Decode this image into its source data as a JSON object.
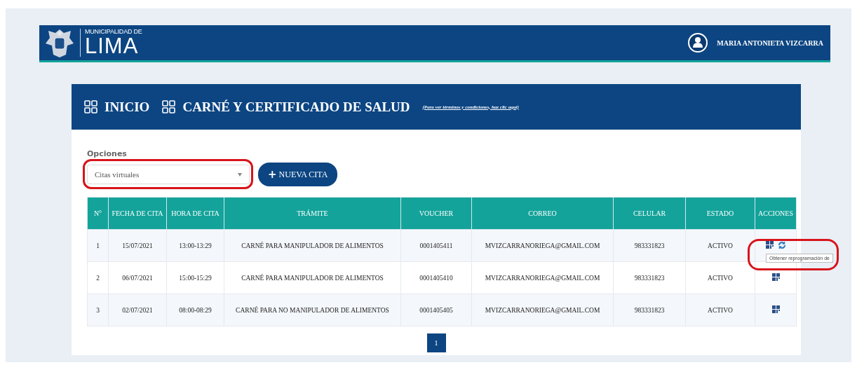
{
  "header": {
    "org_small": "MUNICIPALIDAD DE",
    "org_big": "LIMA",
    "user_name": "MARIA ANTONIETA VIZCARRA"
  },
  "breadcrumb": [
    {
      "label": "INICIO"
    },
    {
      "label": "CARNÉ Y CERTIFICADO DE SALUD"
    }
  ],
  "terms_link": "(Para ver términos y condiciones, haz clic aquí)",
  "options": {
    "label": "Opciones",
    "value": "Citas virtuales",
    "highlighted": true
  },
  "new_button": {
    "icon": "+",
    "label": "NUEVA CITA"
  },
  "table": {
    "columns": [
      "N°",
      "FECHA DE CITA",
      "HORA DE CITA",
      "TRÁMITE",
      "VOUCHER",
      "CORREO",
      "CELULAR",
      "ESTADO",
      "ACCIONES"
    ],
    "rows": [
      {
        "cells": [
          "1",
          "15/07/2021",
          "13:00-13:29",
          "CARNÉ PARA MANIPULADOR DE ALIMENTOS",
          "0001405411",
          "MVIZCARRANORIEGA@GMAIL.COM",
          "983331823",
          "ACTIVO"
        ],
        "actions": [
          {
            "kind": "view"
          },
          {
            "kind": "reschedule"
          }
        ],
        "tooltip": "Obtener reprogramación de",
        "highlighted": true
      },
      {
        "cells": [
          "2",
          "06/07/2021",
          "15:00-15:29",
          "CARNÉ PARA MANIPULADOR DE ALIMENTOS",
          "0001405410",
          "MVIZCARRANORIEGA@GMAIL.COM",
          "983331823",
          "ACTIVO"
        ],
        "actions": [
          {
            "kind": "view"
          }
        ],
        "highlighted": false
      },
      {
        "cells": [
          "3",
          "02/07/2021",
          "08:00-08:29",
          "CARNÉ PARA NO MANIPULADOR DE ALIMENTOS",
          "0001405405",
          "MVIZCARRANORIEGA@GMAIL.COM",
          "983331823",
          "ACTIVO"
        ],
        "actions": [
          {
            "kind": "view"
          }
        ],
        "highlighted": false
      }
    ]
  },
  "pagination": [
    {
      "label": "1",
      "selected": true
    }
  ]
}
